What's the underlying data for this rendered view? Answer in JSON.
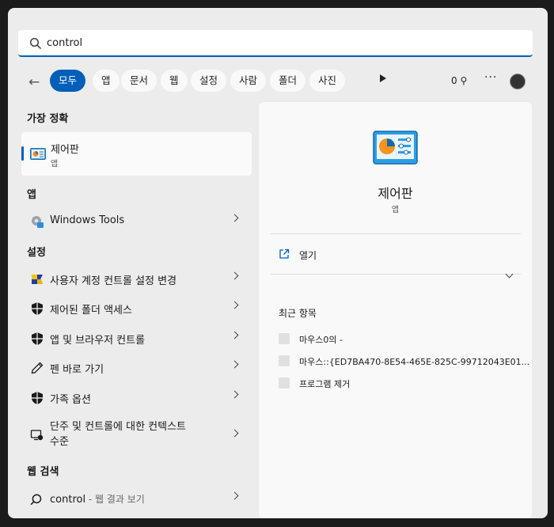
{
  "search": {
    "value": "control"
  },
  "filters": {
    "chips": [
      "모두",
      "앱",
      "문서",
      "웹",
      "설정",
      "사람",
      "폴더",
      "사진"
    ],
    "points": "0"
  },
  "sections": {
    "best_match": "가장 정확",
    "apps": "앱",
    "settings": "설정",
    "web": "웹 검색"
  },
  "best": {
    "title": "제어판",
    "subtitle": "앱"
  },
  "apps": [
    {
      "label": "Windows Tools"
    }
  ],
  "settings": [
    {
      "label": "사용자 계정 컨트롤 설정 변경"
    },
    {
      "label": "제어된 폴더 액세스"
    },
    {
      "label": "앱 및 브라우저 컨트롤"
    },
    {
      "label": "펜 바로 가기"
    },
    {
      "label": "가족 옵션"
    },
    {
      "label": "단주 및 컨트롤에 대한 컨텍스트",
      "label2": "수준"
    }
  ],
  "web": {
    "query": "control",
    "suffix": " - 웹 결과 보기"
  },
  "detail": {
    "title": "제어판",
    "subtitle": "앱",
    "open": "열기",
    "recent_header": "최근 항목",
    "recent": [
      "마우스0의 -",
      "마우스::{ED7BA470-8E54-465E-825C-99712043E01...",
      "프로그램 제거"
    ]
  },
  "colors": {
    "accent": "#005fb8",
    "panel": "#ececec",
    "card": "#f9f9f9"
  }
}
